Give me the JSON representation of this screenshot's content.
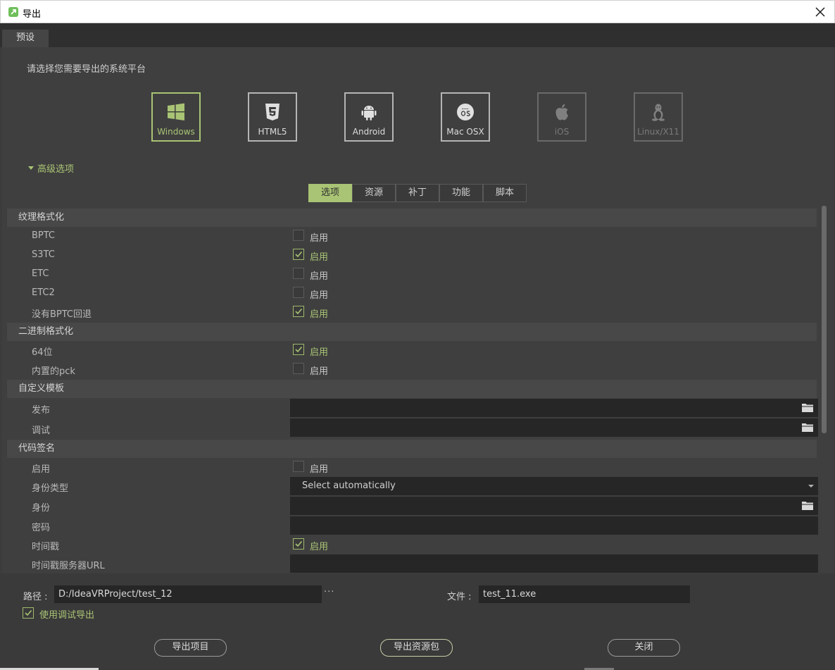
{
  "window": {
    "title": "导出",
    "app_icon": "godot-export-icon",
    "close_icon": "close-icon"
  },
  "preset_tab": "预设",
  "prompt": "请选择您需要导出的系统平台",
  "platforms": [
    {
      "label": "Windows",
      "icon": "windows-icon",
      "state": "active"
    },
    {
      "label": "HTML5",
      "icon": "html5-icon",
      "state": "normal"
    },
    {
      "label": "Android",
      "icon": "android-icon",
      "state": "normal"
    },
    {
      "label": "Mac OSX",
      "icon": "macos-icon",
      "state": "normal"
    },
    {
      "label": "iOS",
      "icon": "apple-icon",
      "state": "disabled"
    },
    {
      "label": "Linux/X11",
      "icon": "linux-icon",
      "state": "disabled"
    }
  ],
  "advanced_label": "高级选项",
  "subtabs": [
    "选项",
    "资源",
    "补丁",
    "功能",
    "脚本"
  ],
  "sections": {
    "texture": "纹理格式化",
    "binary": "二进制格式化",
    "template": "自定义模板",
    "codesign": "代码签名"
  },
  "enable_label": "启用",
  "rows": {
    "bptc": {
      "label": "BPTC",
      "checked": false
    },
    "s3tc": {
      "label": "S3TC",
      "checked": true
    },
    "etc": {
      "label": "ETC",
      "checked": false
    },
    "etc2": {
      "label": "ETC2",
      "checked": false
    },
    "no_bptc": {
      "label": "没有BPTC回退",
      "checked": true
    },
    "bit64": {
      "label": "64位",
      "checked": true
    },
    "embed_pck": {
      "label": "内置的pck",
      "checked": false
    },
    "release": {
      "label": "发布",
      "value": ""
    },
    "debug": {
      "label": "调试",
      "value": ""
    },
    "cs_enable": {
      "label": "启用",
      "checked": false
    },
    "identity_type": {
      "label": "身份类型",
      "value": "Select automatically"
    },
    "identity": {
      "label": "身份",
      "value": ""
    },
    "password": {
      "label": "密码",
      "value": ""
    },
    "timestamp": {
      "label": "时间戳",
      "checked": true
    },
    "timestamp_url": {
      "label": "时间戳服务器URL",
      "value": ""
    }
  },
  "bottom": {
    "path_label": "路径 :",
    "path_value": "D:/IdeaVRProject/test_12",
    "browse_dots": "···",
    "file_label": "文件 :",
    "file_value": "test_11.exe",
    "debug_export_label": "使用调试导出",
    "debug_export_checked": true,
    "export_project_button": "导出项目",
    "export_pack_button": "导出资源包",
    "close_button": "关闭"
  },
  "colors": {
    "accent": "#a9c474",
    "background": "#3c3c3c",
    "field": "#262626"
  }
}
